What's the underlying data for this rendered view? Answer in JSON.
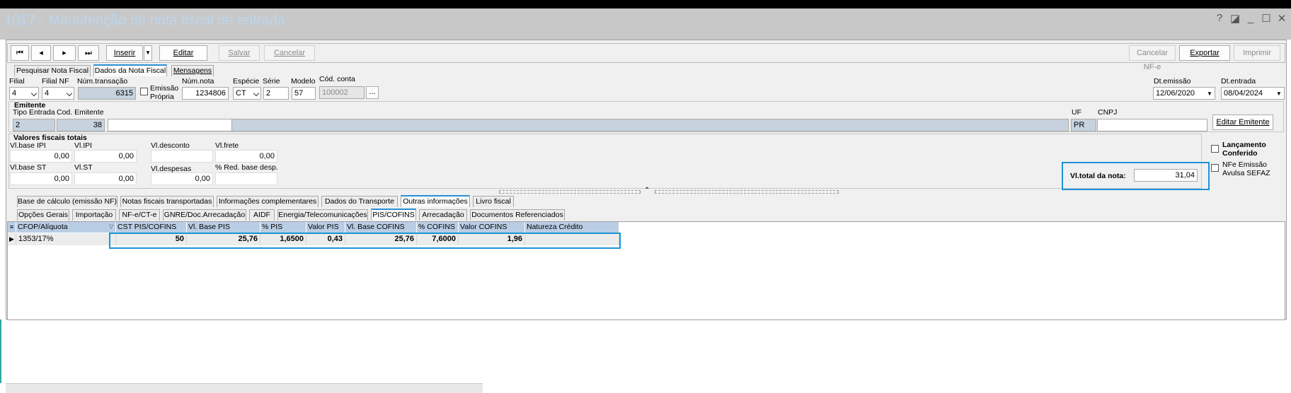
{
  "window": {
    "title": "1017 - Manutenção de nota fiscal de entrada",
    "subtitle": "",
    "buttons": [
      "?",
      "◪",
      "_",
      "☐",
      "✕"
    ]
  },
  "toolbar": {
    "first": "⏮",
    "prev": "◂",
    "next": "▸",
    "last": "⏭",
    "insert": "Inserir",
    "edit": "Editar",
    "save": "Salvar",
    "cancel": "Cancelar",
    "cancel_nfe": "Cancelar NF-e",
    "export": "Exportar",
    "print": "Imprimir"
  },
  "main_tabs": [
    "Pesquisar Nota Fiscal",
    "Dados da Nota Fiscal",
    "Mensagens"
  ],
  "header": {
    "filial_label": "Filial",
    "filial_value": "4",
    "filial_nf_label": "Filial NF",
    "filial_nf_value": "4",
    "num_transacao_label": "Núm.transação",
    "num_transacao_value": "6315",
    "emissao_propria_label_1": "Emissão",
    "emissao_propria_label_2": "Própria",
    "num_nota_label": "Núm.nota",
    "num_nota_value": "1234806",
    "especie_label": "Espécie",
    "especie_value": "CT",
    "serie_label": "Série",
    "serie_value": "2",
    "modelo_label": "Modelo",
    "modelo_value": "57",
    "cod_conta_label": "Cód. conta",
    "cod_conta_value": "100002",
    "cod_conta_btn": "...",
    "dt_emissao_label": "Dt.emissão",
    "dt_emissao_value": "12/06/2020",
    "dt_entrada_label": "Dt.entrada",
    "dt_entrada_value": "08/04/2024"
  },
  "emitente": {
    "title": "Emitente",
    "tipo_entrada_label": "Tipo Entrada",
    "tipo_entrada_value": "2",
    "cod_emitente_label": "Cod. Emitente",
    "cod_emitente_value": "38",
    "uf_label": "UF",
    "uf_value": "PR",
    "cnpj_label": "CNPJ",
    "cnpj_value": "",
    "edit_button": "Editar Emitente"
  },
  "valores": {
    "title": "Valores fiscais totais",
    "base_ipi_label": "Vl.base IPI",
    "base_ipi_value": "0,00",
    "ipi_label": "Vl.IPI",
    "ipi_value": "0,00",
    "desconto_label": "Vl.desconto",
    "desconto_value": "",
    "frete_label": "Vl.frete",
    "frete_value": "0,00",
    "base_st_label": "Vl.base ST",
    "base_st_value": "0,00",
    "st_label": "Vl.ST",
    "st_value": "0,00",
    "despesas_label": "Vl.despesas",
    "despesas_value": "0,00",
    "red_base_label": "% Red. base desp.",
    "red_base_value": "",
    "total_label": "Vl.total da nota:",
    "total_value": "31,04"
  },
  "flags": {
    "lancamento_1": "Lançamento",
    "lancamento_2": "Conferido",
    "nfe_1": "NFe Emissão",
    "nfe_2": "Avulsa SEFAZ"
  },
  "sub_tabs_1": [
    "Base de cálculo (emissão NF)",
    "Notas fiscais transportadas",
    "Informações complementares",
    "Dados do Transporte",
    "Outras informações",
    "Livro fiscal"
  ],
  "sub_tabs_2": [
    "Opções Gerais",
    "Importação",
    "NF-e/CT-e",
    "GNRE/Doc.Arrecadação",
    "AIDF",
    "Energia/Telecomunicações",
    "PIS/COFINS",
    "Arrecadação",
    "Documentos Referenciados"
  ],
  "grid": {
    "columns": [
      "CFOP/Alíquota",
      "CST PIS/COFINS",
      "Vl. Base PIS",
      "% PIS",
      "Valor PIS",
      "Vl. Base COFINS",
      "% COFINS",
      "Valor COFINS",
      "Natureza Crédito"
    ],
    "rows": [
      [
        "1353/17%",
        "50",
        "25,76",
        "1,6500",
        "0,43",
        "25,76",
        "7,6000",
        "1,96",
        ""
      ]
    ]
  }
}
